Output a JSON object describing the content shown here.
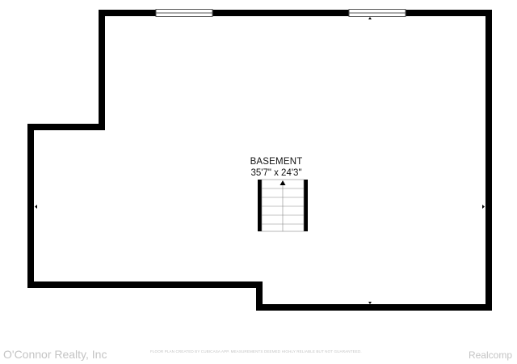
{
  "plan": {
    "room_name": "BASEMENT",
    "room_dimensions": "35'7\" x 24'3\""
  },
  "footer": {
    "brokerage": "O'Connor Realty, Inc",
    "disclaimer": "FLOOR PLAN CREATED BY CUBICASA APP. MEASUREMENTS DEEMED HIGHLY RELIABLE BUT NOT GUARANTEED.",
    "source": "Realcomp"
  },
  "colors": {
    "wall": "#000000",
    "background": "#ffffff",
    "watermark": "#c4c4c4"
  }
}
